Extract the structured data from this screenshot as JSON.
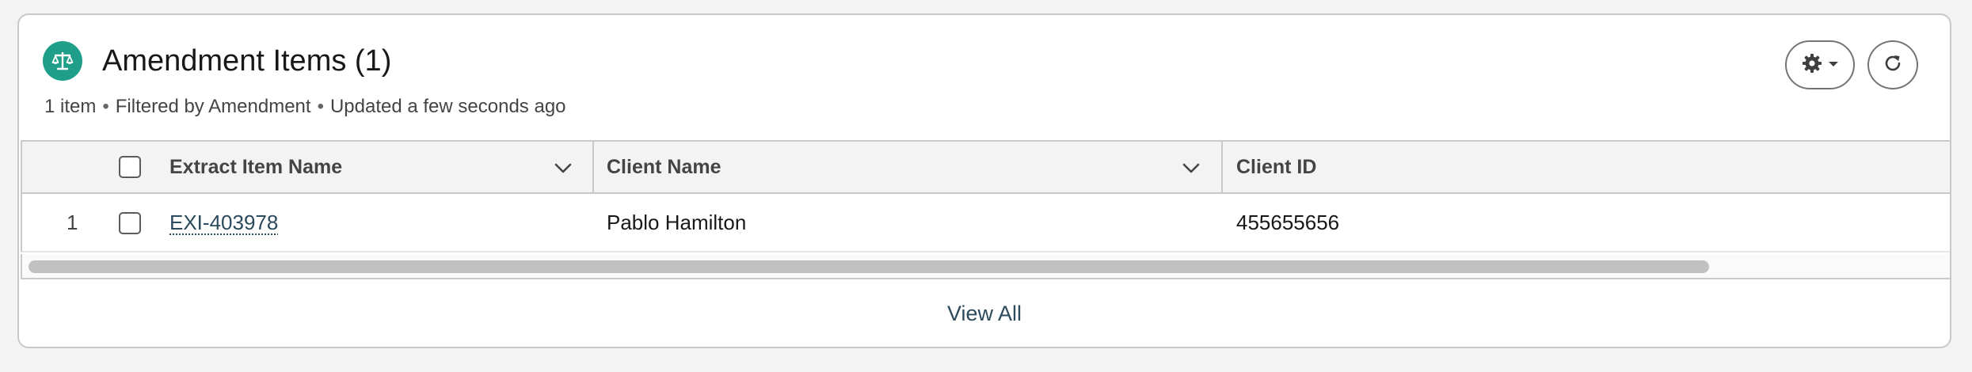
{
  "card": {
    "title": "Amendment Items (1)",
    "icon": "scales-icon",
    "subtitle": {
      "count": "1 item",
      "filter": "Filtered by Amendment",
      "updated": "Updated a few seconds ago",
      "separator": "•"
    },
    "actions": {
      "settings_icon": "gear-icon",
      "refresh_icon": "refresh-icon"
    }
  },
  "table": {
    "columns": [
      {
        "label": "Extract Item Name",
        "sortable_menu": true
      },
      {
        "label": "Client Name",
        "sortable_menu": true
      },
      {
        "label": "Client ID",
        "sortable_menu": false
      }
    ],
    "rows": [
      {
        "row_number": "1",
        "extract_item_name": "EXI-403978",
        "client_name": "Pablo Hamilton",
        "client_id": "455655656"
      }
    ]
  },
  "footer": {
    "view_all_label": "View All"
  },
  "colors": {
    "accent": "#1f9e89",
    "link": "#2b4a5c",
    "header_bg": "#f3f3f3",
    "border": "#c9c9c9"
  }
}
